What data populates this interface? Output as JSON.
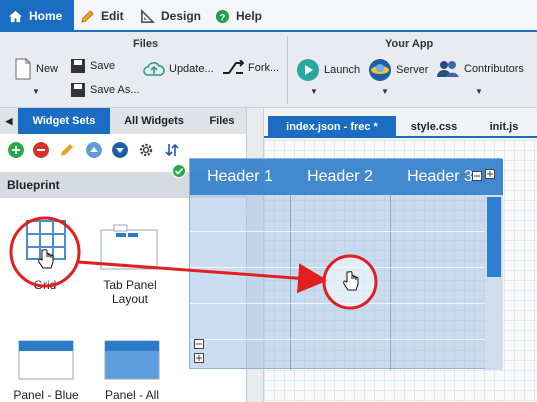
{
  "menu": {
    "home": "Home",
    "edit": "Edit",
    "design": "Design",
    "help": "Help"
  },
  "ribbon": {
    "files_group": "Files",
    "new_label": "New",
    "save_label": "Save",
    "save_as_label": "Save As...",
    "update_label": "Update...",
    "fork_label": "Fork...",
    "app_group": "Your App",
    "launch_label": "Launch",
    "server_label": "Server",
    "contributors_label": "Contributors"
  },
  "left_panel": {
    "tabs": [
      "Widget Sets",
      "All Widgets",
      "Files"
    ],
    "section_title": "Blueprint",
    "widgets": [
      {
        "label": "Grid",
        "icon": "grid-icon"
      },
      {
        "label": "Tab Panel Layout",
        "icon": "tab-panel-icon"
      },
      {
        "label": "Panel - Blue",
        "icon": "panel-blue-icon"
      },
      {
        "label": "Panel - All",
        "icon": "panel-all-icon"
      }
    ]
  },
  "editor": {
    "tabs": [
      "index.json - frec *",
      "style.css",
      "init.js"
    ],
    "active_tab": "index.json - frec *"
  },
  "grid_preview": {
    "headers": [
      "Header 1",
      "Header 2",
      "Header 3"
    ]
  },
  "colors": {
    "accent": "#1a6dc2",
    "highlight": "#e02020",
    "grid_header": "#2c7ac8"
  }
}
